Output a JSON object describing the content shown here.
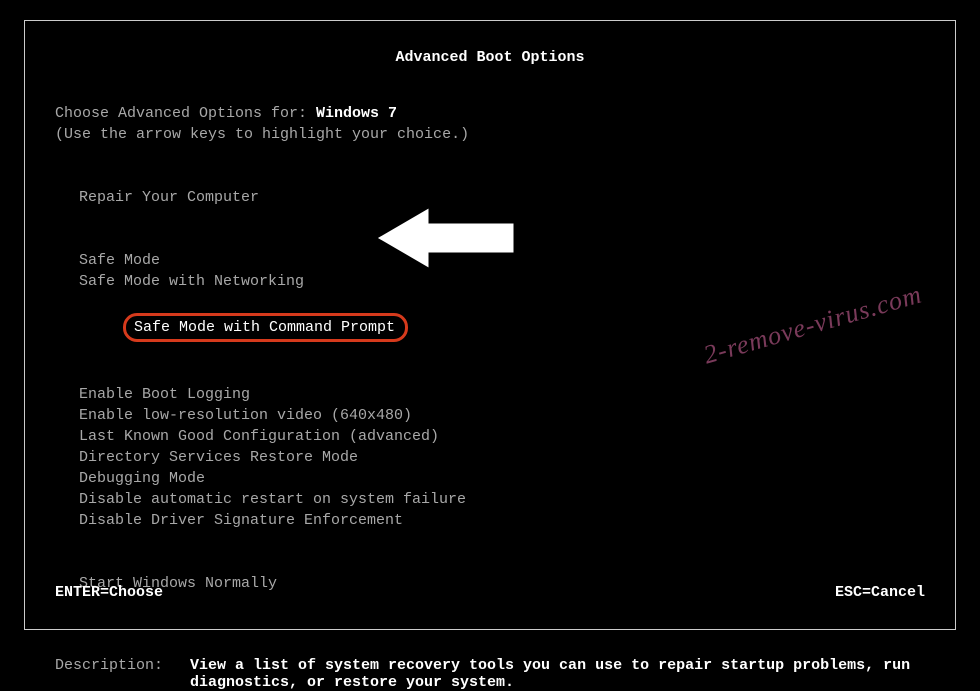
{
  "title": "Advanced Boot Options",
  "choose_prefix": "Choose Advanced Options for: ",
  "os_name": "Windows 7",
  "instruction": "(Use the arrow keys to highlight your choice.)",
  "group1": [
    "Repair Your Computer"
  ],
  "group2": [
    "Safe Mode",
    "Safe Mode with Networking",
    "Safe Mode with Command Prompt"
  ],
  "group3": [
    "Enable Boot Logging",
    "Enable low-resolution video (640x480)",
    "Last Known Good Configuration (advanced)",
    "Directory Services Restore Mode",
    "Debugging Mode",
    "Disable automatic restart on system failure",
    "Disable Driver Signature Enforcement"
  ],
  "group4": [
    "Start Windows Normally"
  ],
  "selected_index_in_group2": 2,
  "description_label": "Description:",
  "description_text": "View a list of system recovery tools you can use to repair startup problems, run diagnostics, or restore your system.",
  "footer": {
    "enter": "ENTER=Choose",
    "esc": "ESC=Cancel"
  },
  "watermark": "2-remove-virus.com"
}
